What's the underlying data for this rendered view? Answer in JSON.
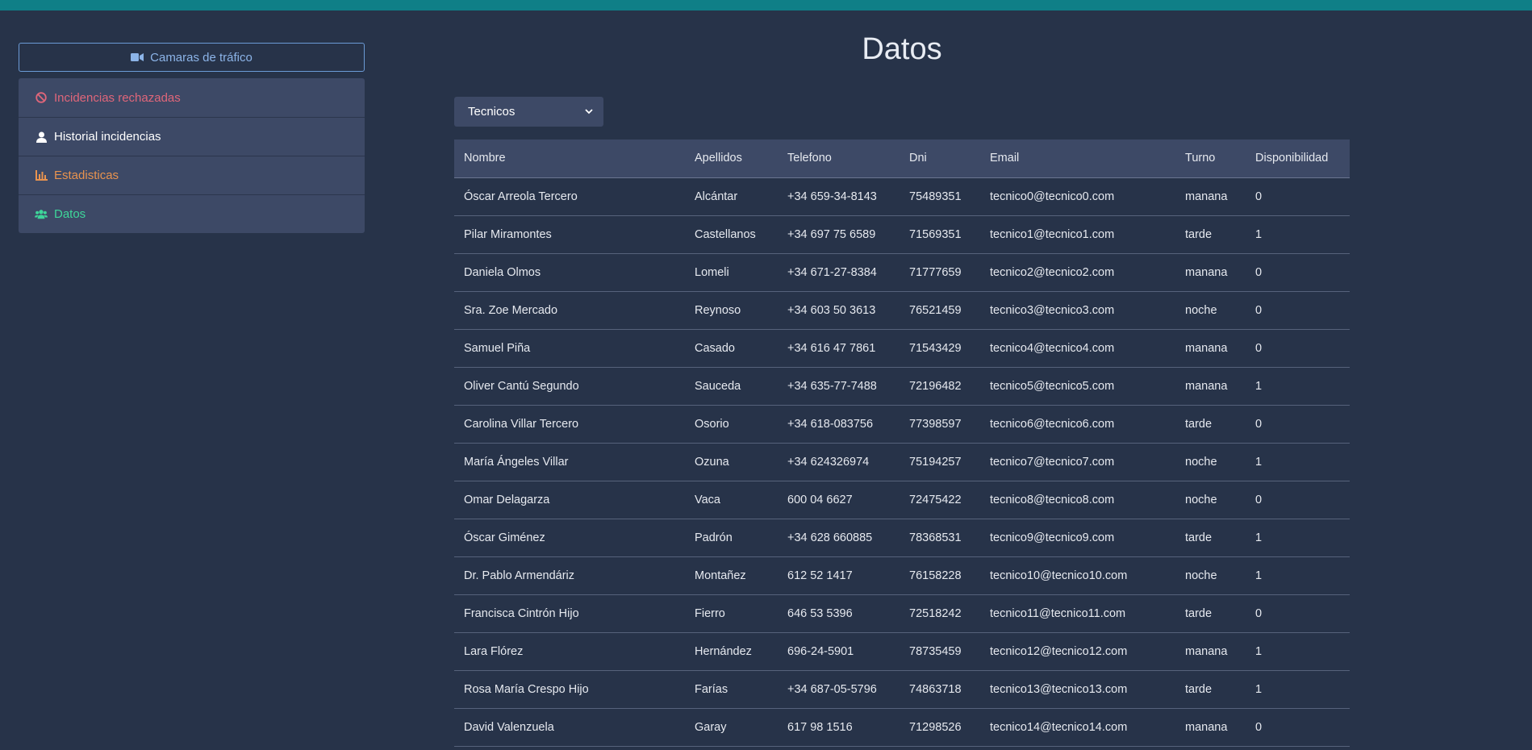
{
  "sidebar": {
    "camera_button": "Camaras de tráfico",
    "items": [
      {
        "label": "Incidencias rechazadas",
        "icon": "ban-icon"
      },
      {
        "label": "Historial incidencias",
        "icon": "user-icon"
      },
      {
        "label": "Estadisticas",
        "icon": "chart-icon"
      },
      {
        "label": "Datos",
        "icon": "users-icon"
      }
    ]
  },
  "main": {
    "title": "Datos",
    "select": {
      "value": "Tecnicos"
    },
    "table": {
      "headers": [
        "Nombre",
        "Apellidos",
        "Telefono",
        "Dni",
        "Email",
        "Turno",
        "Disponibilidad"
      ],
      "rows": [
        [
          "Óscar Arreola Tercero",
          "Alcántar",
          "+34 659-34-8143",
          "75489351",
          "tecnico0@tecnico0.com",
          "manana",
          "0"
        ],
        [
          "Pilar Miramontes",
          "Castellanos",
          "+34 697 75 6589",
          "71569351",
          "tecnico1@tecnico1.com",
          "tarde",
          "1"
        ],
        [
          "Daniela Olmos",
          "Lomeli",
          "+34 671-27-8384",
          "71777659",
          "tecnico2@tecnico2.com",
          "manana",
          "0"
        ],
        [
          "Sra. Zoe Mercado",
          "Reynoso",
          "+34 603 50 3613",
          "76521459",
          "tecnico3@tecnico3.com",
          "noche",
          "0"
        ],
        [
          "Samuel Piña",
          "Casado",
          "+34 616 47 7861",
          "71543429",
          "tecnico4@tecnico4.com",
          "manana",
          "0"
        ],
        [
          "Oliver Cantú Segundo",
          "Sauceda",
          "+34 635-77-7488",
          "72196482",
          "tecnico5@tecnico5.com",
          "manana",
          "1"
        ],
        [
          "Carolina Villar Tercero",
          "Osorio",
          "+34 618-083756",
          "77398597",
          "tecnico6@tecnico6.com",
          "tarde",
          "0"
        ],
        [
          "María Ángeles Villar",
          "Ozuna",
          "+34 624326974",
          "75194257",
          "tecnico7@tecnico7.com",
          "noche",
          "1"
        ],
        [
          "Omar Delagarza",
          "Vaca",
          "600 04 6627",
          "72475422",
          "tecnico8@tecnico8.com",
          "noche",
          "0"
        ],
        [
          "Óscar Giménez",
          "Padrón",
          "+34 628 660885",
          "78368531",
          "tecnico9@tecnico9.com",
          "tarde",
          "1"
        ],
        [
          "Dr. Pablo Armendáriz",
          "Montañez",
          "612 52 1417",
          "76158228",
          "tecnico10@tecnico10.com",
          "noche",
          "1"
        ],
        [
          "Francisca Cintrón Hijo",
          "Fierro",
          "646 53 5396",
          "72518242",
          "tecnico11@tecnico11.com",
          "tarde",
          "0"
        ],
        [
          "Lara Flórez",
          "Hernández",
          "696-24-5901",
          "78735459",
          "tecnico12@tecnico12.com",
          "manana",
          "1"
        ],
        [
          "Rosa María Crespo Hijo",
          "Farías",
          "+34 687-05-5796",
          "74863718",
          "tecnico13@tecnico13.com",
          "tarde",
          "1"
        ],
        [
          "David Valenzuela",
          "Garay",
          "617 98 1516",
          "71298526",
          "tecnico14@tecnico14.com",
          "manana",
          "0"
        ]
      ]
    }
  },
  "colors": {
    "background": "#273349",
    "topbar": "#0f7f87",
    "panel": "#3d4966",
    "danger": "#e0667a",
    "warning": "#e8934f",
    "success": "#3ed69a",
    "info": "#8cb4e8"
  }
}
